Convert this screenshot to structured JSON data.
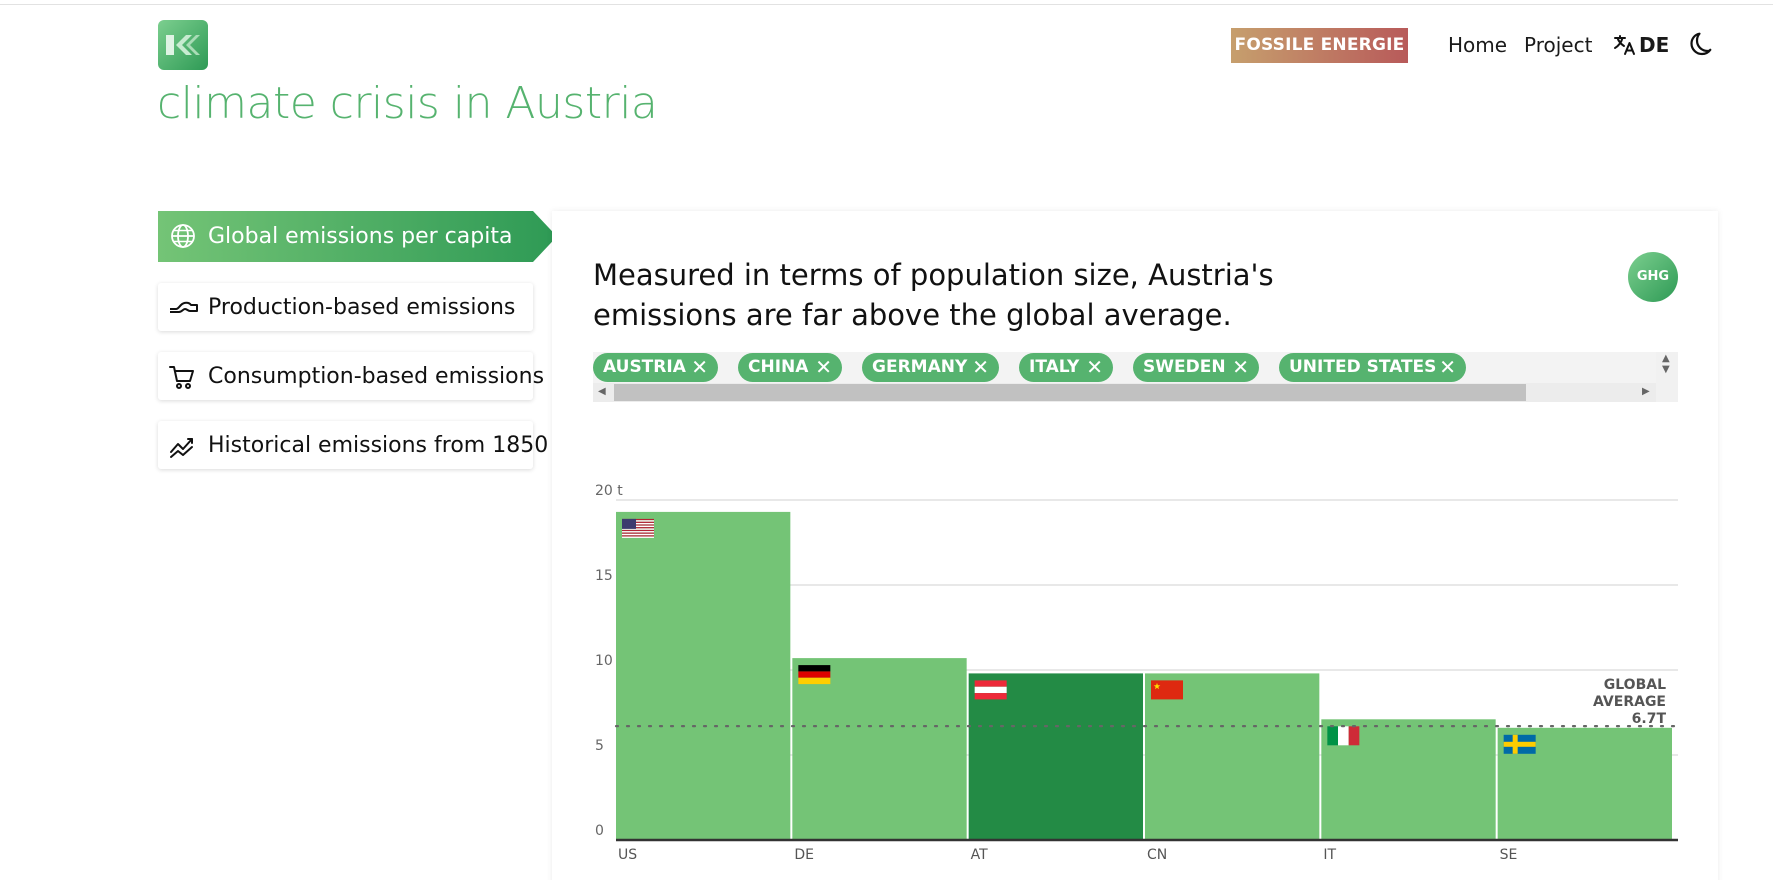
{
  "header": {
    "title": "climate crisis in Austria",
    "badge": "FOSSILE ENERGIE",
    "nav": {
      "home": "Home",
      "project": "Project"
    },
    "language": "DE"
  },
  "sidebar": {
    "items": [
      {
        "label": "Global emissions per capita",
        "icon": "globe-icon",
        "active": true
      },
      {
        "label": "Production-based emissions",
        "icon": "pipe-icon",
        "active": false
      },
      {
        "label": "Consumption-based emissions",
        "icon": "cart-icon",
        "active": false
      },
      {
        "label": "Historical emissions from 1850",
        "icon": "chart-line-icon",
        "active": false
      }
    ]
  },
  "main": {
    "headline": "Measured in terms of population size, Austria's emissions are far above the global average.",
    "ghg_badge": "GHG",
    "chips": [
      "AUSTRIA",
      "CHINA",
      "GERMANY",
      "ITALY",
      "SWEDEN",
      "UNITED STATES"
    ],
    "chip_close": "✕"
  },
  "colors": {
    "accent": "#56b36f",
    "bar": "#74c476",
    "bar_highlight": "#238b45",
    "badge_start": "#c69f6d",
    "badge_end": "#b85a5a"
  },
  "chart_data": {
    "type": "bar",
    "categories": [
      "US",
      "DE",
      "AT",
      "CN",
      "IT",
      "SE"
    ],
    "values": [
      19.3,
      10.7,
      9.8,
      9.8,
      7.1,
      6.6
    ],
    "highlight": "AT",
    "flags": [
      "us",
      "de",
      "at",
      "cn",
      "it",
      "se"
    ],
    "ylim": [
      0,
      20
    ],
    "yticks": [
      0,
      5,
      10,
      15,
      20
    ],
    "ytick_labels": [
      "0",
      "5",
      "10",
      "15",
      "20 t"
    ],
    "reference_line": {
      "value": 6.7,
      "label": [
        "GLOBAL",
        "AVERAGE",
        "6.7T"
      ]
    },
    "grid": true
  }
}
